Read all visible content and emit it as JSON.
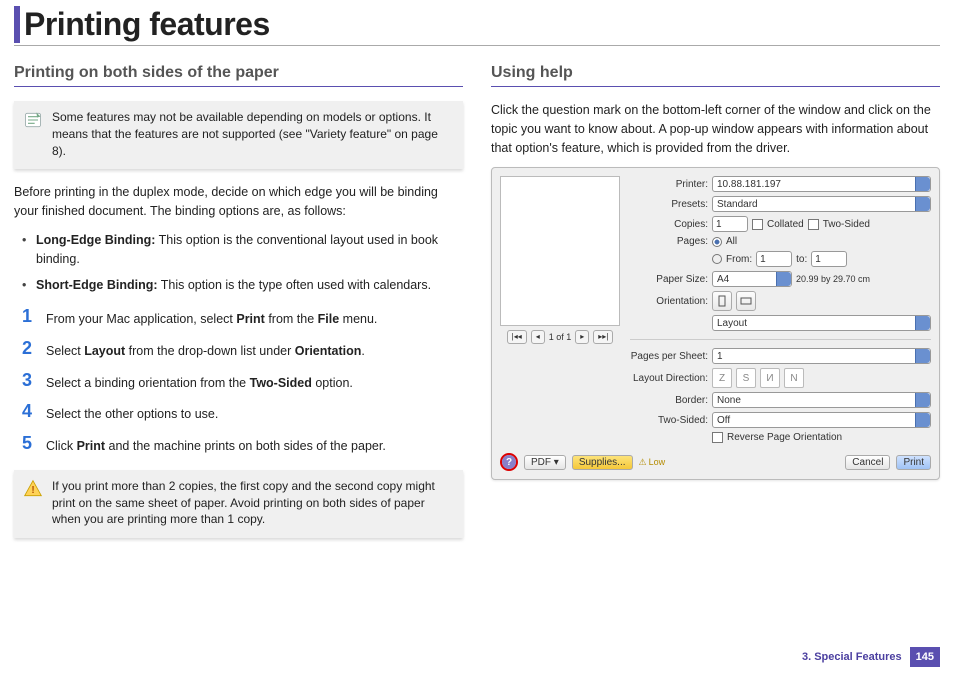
{
  "page": {
    "title": "Printing features",
    "chapter_label": "3.  Special Features",
    "page_number": "145"
  },
  "left": {
    "heading": "Printing on both sides of the paper",
    "note": "Some features may not be available depending on models or options. It means that the features are not supported (see \"Variety feature\" on page 8).",
    "intro": "Before printing in the duplex mode, decide on which edge you will be binding your finished document. The binding options are, as follows:",
    "bullets": [
      {
        "term": "Long-Edge Binding:",
        "desc": " This option is the conventional layout used in book binding."
      },
      {
        "term": "Short-Edge Binding:",
        "desc": " This option is the type often used with calendars."
      }
    ],
    "steps": [
      {
        "n": "1",
        "pre": "From your Mac application, select ",
        "b1": "Print",
        "mid": " from the ",
        "b2": "File",
        "post": " menu."
      },
      {
        "n": "2",
        "pre": "Select ",
        "b1": "Layout",
        "mid": " from the drop-down list under ",
        "b2": "Orientation",
        "post": "."
      },
      {
        "n": "3",
        "pre": "Select a binding orientation from the ",
        "b1": "Two-Sided",
        "mid": "",
        "b2": "",
        "post": " option."
      },
      {
        "n": "4",
        "pre": "Select the other options to use.",
        "b1": "",
        "mid": "",
        "b2": "",
        "post": ""
      },
      {
        "n": "5",
        "pre": "Click ",
        "b1": "Print",
        "mid": " and the machine prints on both sides of the paper.",
        "b2": "",
        "post": ""
      }
    ],
    "warn": "If you print more than 2 copies, the first copy and the second copy might print on the same sheet of paper. Avoid printing on both sides of paper when you are printing more than 1 copy."
  },
  "right": {
    "heading": "Using help",
    "intro": "Click the question mark on the bottom-left corner of the window and click on the topic you want to know about. A pop-up window appears with information about that option's feature, which is provided from the driver."
  },
  "dialog": {
    "printer_label": "Printer:",
    "printer_value": "10.88.181.197",
    "presets_label": "Presets:",
    "presets_value": "Standard",
    "copies_label": "Copies:",
    "copies_value": "1",
    "collated_label": "Collated",
    "two_sided_chk_label": "Two-Sided",
    "pages_label": "Pages:",
    "pages_all": "All",
    "pages_from": "From:",
    "pages_from_v": "1",
    "pages_to": "to:",
    "pages_to_v": "1",
    "papersize_label": "Paper Size:",
    "papersize_value": "A4",
    "papersize_dims": "20.99 by 29.70 cm",
    "orientation_label": "Orientation:",
    "section_value": "Layout",
    "pps_label": "Pages per Sheet:",
    "pps_value": "1",
    "layoutdir_label": "Layout Direction:",
    "border_label": "Border:",
    "border_value": "None",
    "twosided_label": "Two-Sided:",
    "twosided_value": "Off",
    "reverse_label": "Reverse Page Orientation",
    "prev_nav": "1 of 1",
    "pdf_btn": "PDF ▾",
    "supplies_btn": "Supplies...",
    "low_label": "Low",
    "cancel_btn": "Cancel",
    "print_btn": "Print"
  }
}
